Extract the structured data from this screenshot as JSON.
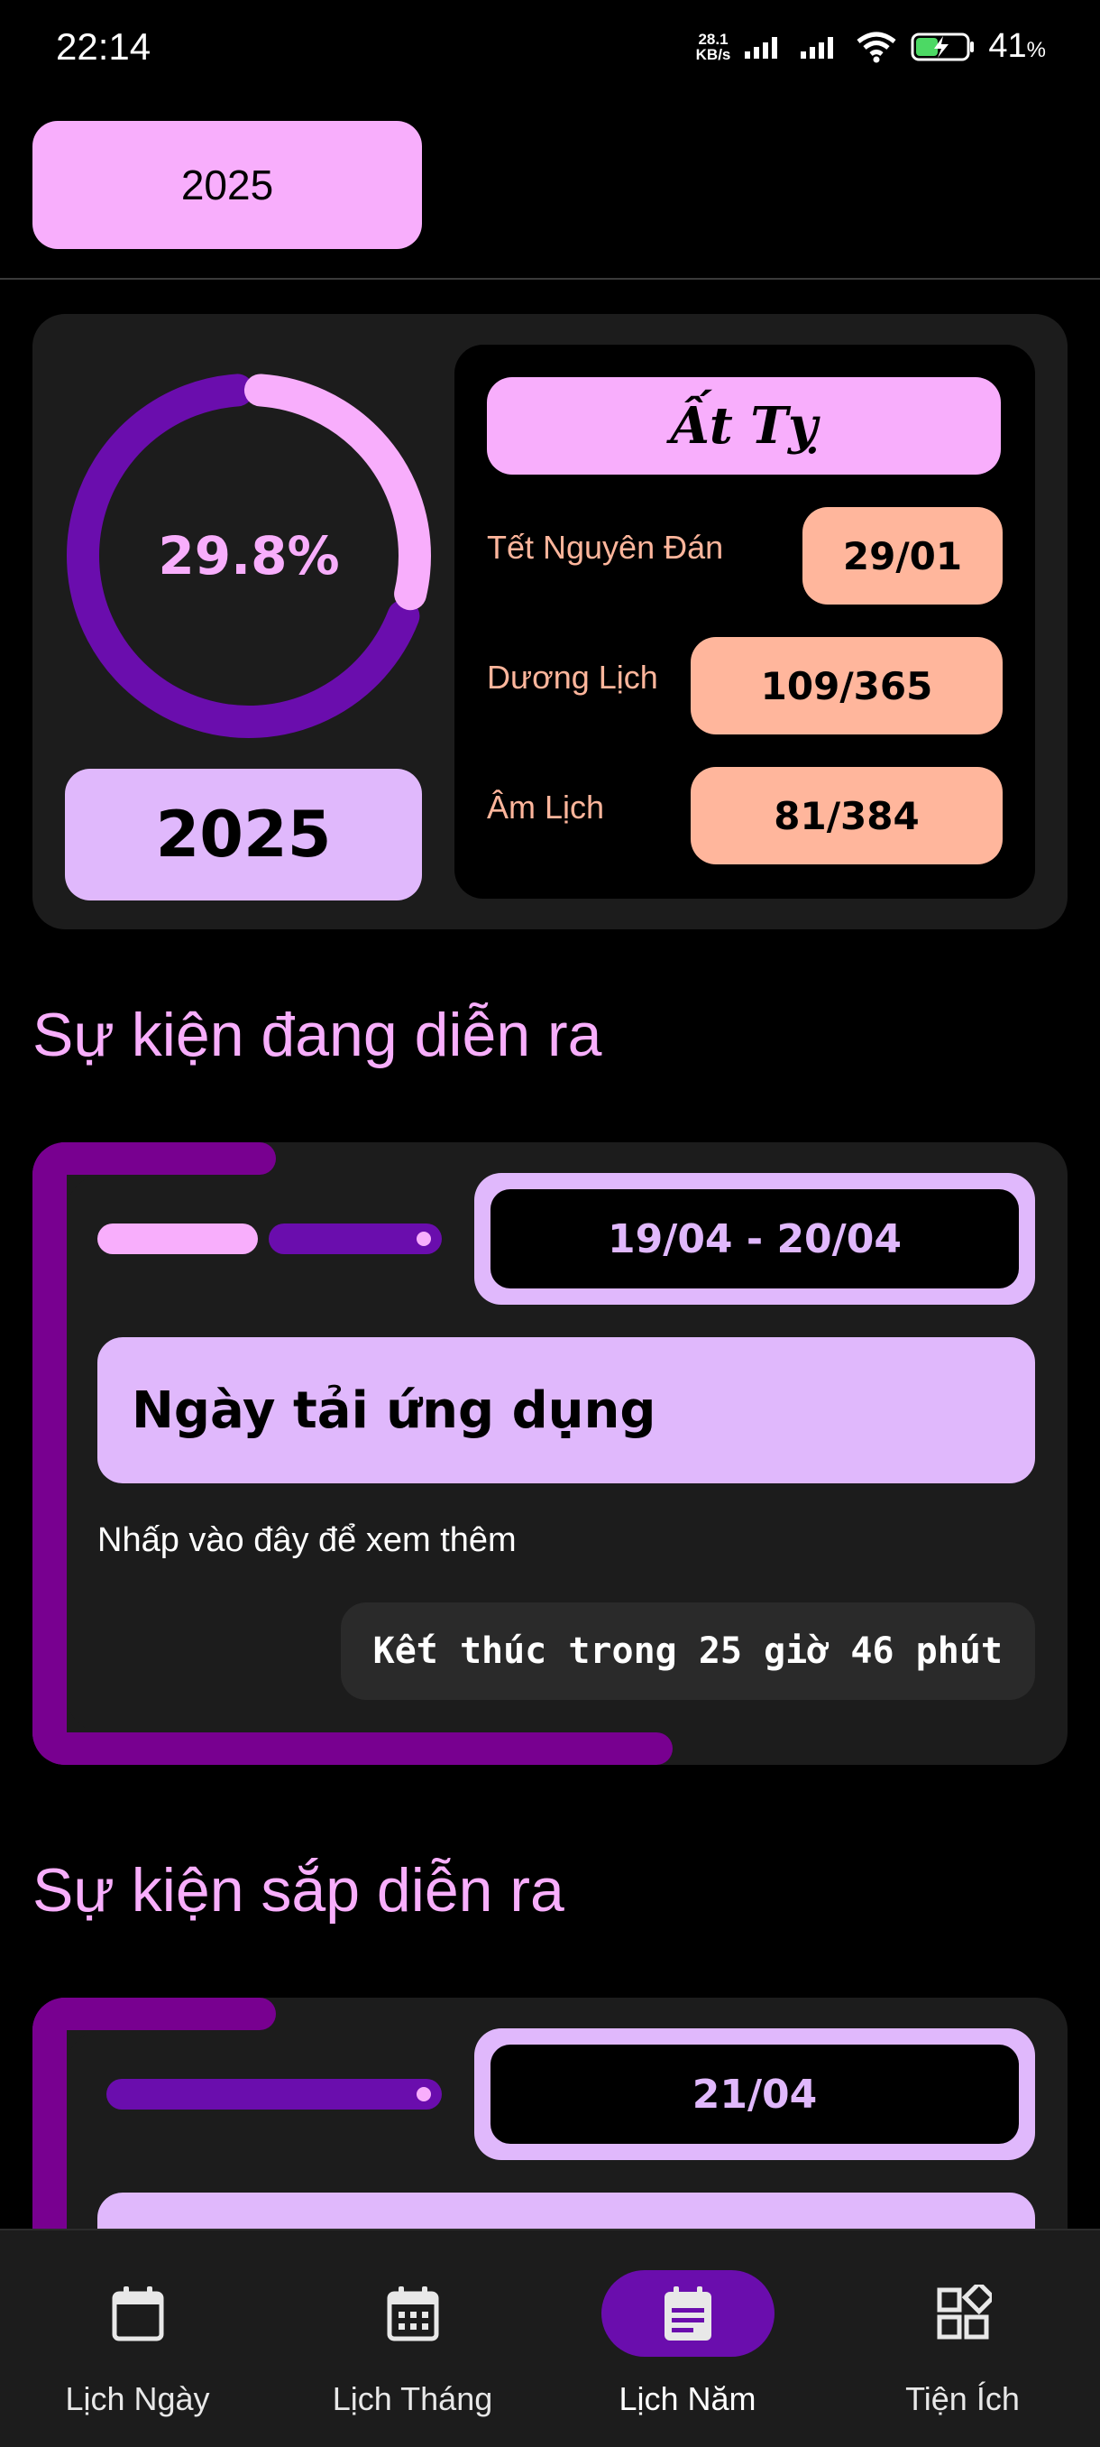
{
  "status_bar": {
    "time": "22:14",
    "net_speed_value": "28.1",
    "net_speed_unit": "KB/s",
    "battery_percent": "41",
    "battery_unit": "%"
  },
  "header": {
    "year_selector": "2025"
  },
  "summary": {
    "progress_percent": 29.8,
    "progress_label": "29.8%",
    "year": "2025",
    "can_chi": "Ất Tỵ",
    "rows": [
      {
        "label": "Tết Nguyên Đán",
        "value": "29/01"
      },
      {
        "label": "Dương Lịch",
        "value": "109/365"
      },
      {
        "label": "Âm Lịch",
        "value": "81/384"
      }
    ]
  },
  "ongoing": {
    "section_title": "Sự kiện đang diễn ra",
    "events": [
      {
        "date_range": "19/04 - 20/04",
        "title": "Ngày tải ứng dụng",
        "description": "Nhấp vào đây để xem thêm",
        "countdown": "Kết thúc trong 25 giờ 46 phút"
      }
    ]
  },
  "upcoming": {
    "section_title": "Sự kiện sắp diễn ra",
    "events": [
      {
        "date_range": "21/04"
      }
    ]
  },
  "bottom_nav": {
    "items": [
      {
        "label": "Lịch Ngày",
        "icon": "calendar-blank-icon",
        "active": false
      },
      {
        "label": "Lịch Tháng",
        "icon": "calendar-month-icon",
        "active": false
      },
      {
        "label": "Lịch Năm",
        "icon": "calendar-year-icon",
        "active": true
      },
      {
        "label": "Tiện Ích",
        "icon": "widgets-icon",
        "active": false
      }
    ]
  },
  "colors": {
    "accent_pink": "#f8aefc",
    "accent_lavender": "#e0b8fc",
    "accent_purple": "#6a0dad",
    "accent_peach": "#ffb69c"
  }
}
